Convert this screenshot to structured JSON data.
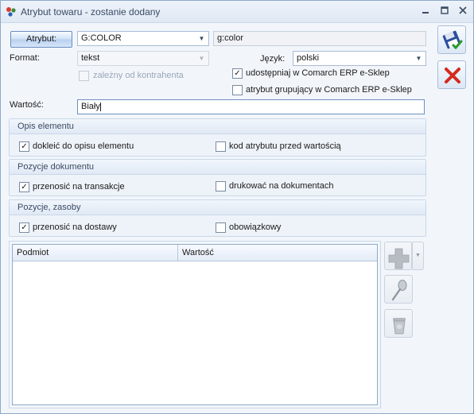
{
  "window": {
    "title": "Atrybut towaru - zostanie dodany"
  },
  "form": {
    "attribute_button": "Atrybut:",
    "attribute_value": "G:COLOR",
    "attribute_name": "g:color",
    "format_label": "Format:",
    "format_value": "tekst",
    "language_label": "Język:",
    "language_value": "polski",
    "dependent_label": "zależny od kontrahenta",
    "share_eshop_label": "udostępniaj w Comarch ERP e-Sklep",
    "grouping_label": "atrybut grupujący w Comarch ERP e-Sklep",
    "value_label": "Wartość:",
    "value_text": "Biały"
  },
  "sections": {
    "description": {
      "title": "Opis elementu",
      "option1": "dokleić do opisu elementu",
      "option2": "kod atrybutu przed wartością"
    },
    "document": {
      "title": "Pozycje dokumentu",
      "option1": "przenosić na transakcje",
      "option2": "drukować na dokumentach"
    },
    "stock": {
      "title": "Pozycje, zasoby",
      "option1": "przenosić na dostawy",
      "option2": "obowiązkowy"
    }
  },
  "table": {
    "columns": [
      "Podmiot",
      "Wartość"
    ],
    "rows": []
  },
  "checks": {
    "dependent": false,
    "share_eshop": true,
    "grouping": false,
    "desc_append": true,
    "desc_code_before": false,
    "doc_transfer": true,
    "doc_print": false,
    "stock_transfer": true,
    "stock_mandatory": false
  },
  "icons": {
    "save": "save-floppy-check-icon",
    "cancel": "red-x-icon",
    "add": "plus-icon",
    "edit": "spoon-magnifier-icon",
    "delete": "trash-bin-icon"
  }
}
